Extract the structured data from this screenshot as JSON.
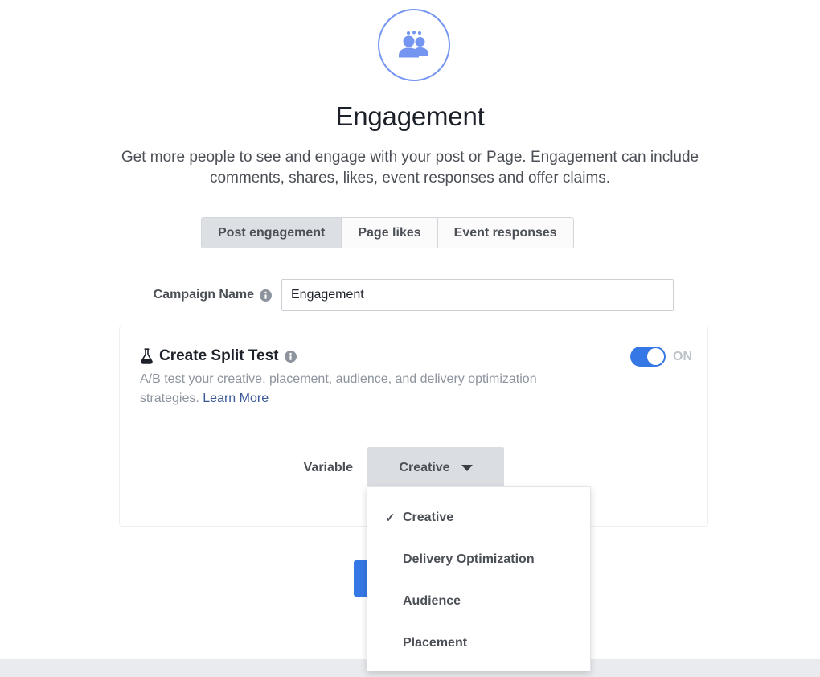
{
  "header": {
    "icon": "people-group-icon",
    "title": "Engagement",
    "description": "Get more people to see and engage with your post or Page. Engagement can include comments, shares, likes, event responses and offer claims."
  },
  "tabs": [
    {
      "label": "Post engagement",
      "selected": true
    },
    {
      "label": "Page likes",
      "selected": false
    },
    {
      "label": "Event responses",
      "selected": false
    }
  ],
  "campaign_name": {
    "label": "Campaign Name",
    "info_icon": "info-icon",
    "value": "Engagement",
    "placeholder": ""
  },
  "split_test": {
    "flask_icon": "flask-icon",
    "title": "Create Split Test",
    "info_icon": "info-icon",
    "description": "A/B test your creative, placement, audience, and delivery optimization strategies. ",
    "learn_more": "Learn More",
    "toggle_state": "ON",
    "toggle_label": "ON",
    "variable": {
      "label": "Variable",
      "selected": "Creative",
      "caret_icon": "chevron-down-icon",
      "options": [
        {
          "label": "Creative",
          "checked": true
        },
        {
          "label": "Delivery Optimization",
          "checked": false
        },
        {
          "label": "Audience",
          "checked": false
        },
        {
          "label": "Placement",
          "checked": false
        }
      ]
    }
  },
  "primary_button": {
    "label": ""
  },
  "footer": {
    "text": ""
  },
  "colors": {
    "accent_blue": "#3578e5",
    "icon_blue": "#7596f0",
    "link_blue": "#3b5998",
    "tab_selected_bg": "#dcdfe4",
    "dropdown_bg": "#dadee3",
    "muted_text": "#8d949e",
    "footer_bg": "#e9ebee"
  }
}
